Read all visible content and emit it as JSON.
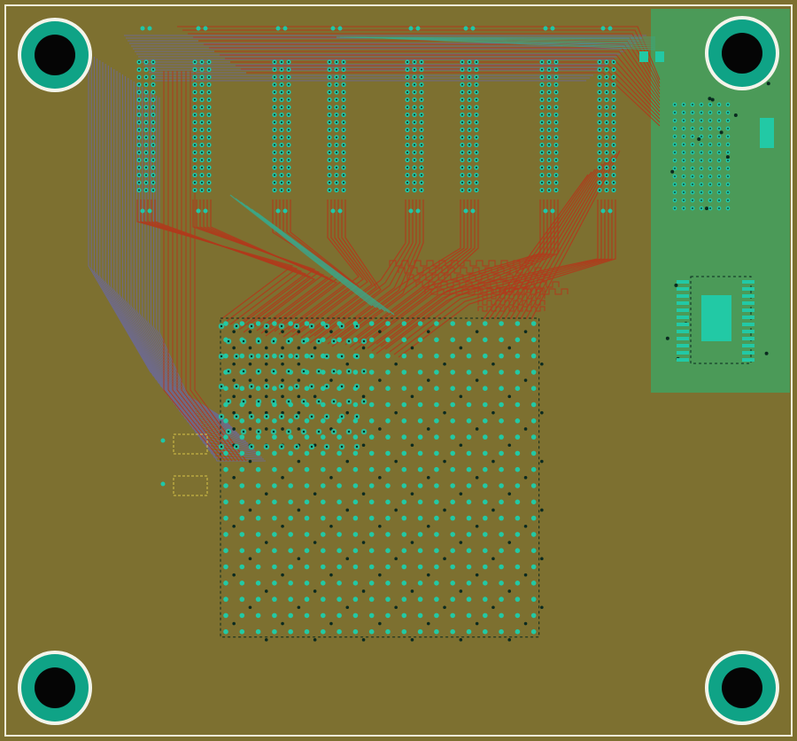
{
  "view": {
    "kind": "pcb-layout-view",
    "layers_visible": [
      "top-copper",
      "bottom-copper",
      "vias",
      "pads",
      "board-outline"
    ]
  },
  "colors": {
    "board_fill": "#7d7030",
    "board_outline": "#f2eed8",
    "copper_pour": "#4b9a58",
    "trace_top": "#b03a1c",
    "trace_bottom": "#6e6a8a",
    "trace_inner": "#3aa88a",
    "via_ring": "#1ec7a8",
    "via_drill": "#0a2a20",
    "pad": "#22c9a5",
    "mount_ring": "#0fa386",
    "mount_outer": "#f4f4ea",
    "mount_hole": "#050505",
    "silkscreen": "#d6c548"
  },
  "components": {
    "mounting_holes": 4,
    "connector_columns": 8,
    "bga_package": {
      "rows": 20,
      "cols": 20
    },
    "qfn_package": 1,
    "passive_pads": 3
  }
}
